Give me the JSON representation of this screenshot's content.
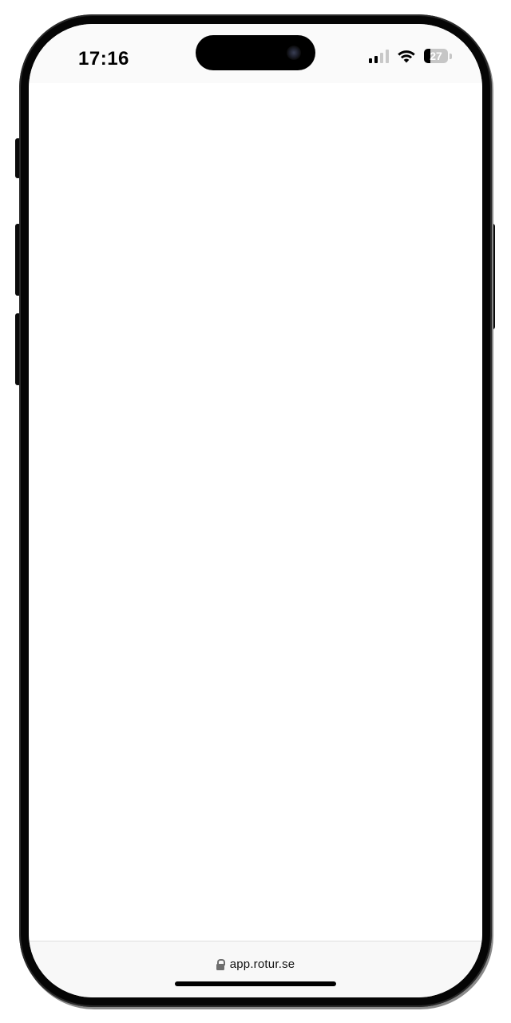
{
  "status_bar": {
    "time": "17:16",
    "battery_level": "27",
    "battery_fraction": 0.27,
    "signal_bars_active": 2,
    "signal_bars_total": 4,
    "icons": [
      "cellular-signal-icon",
      "wifi-icon",
      "battery-icon"
    ]
  },
  "browser": {
    "url": "app.rotur.se",
    "secure": true
  },
  "colors": {
    "frame": "#050505",
    "status_bar_bg": "#fafafa",
    "address_bar_bg": "#f8f8f8",
    "lock": "#6e6e6e"
  }
}
